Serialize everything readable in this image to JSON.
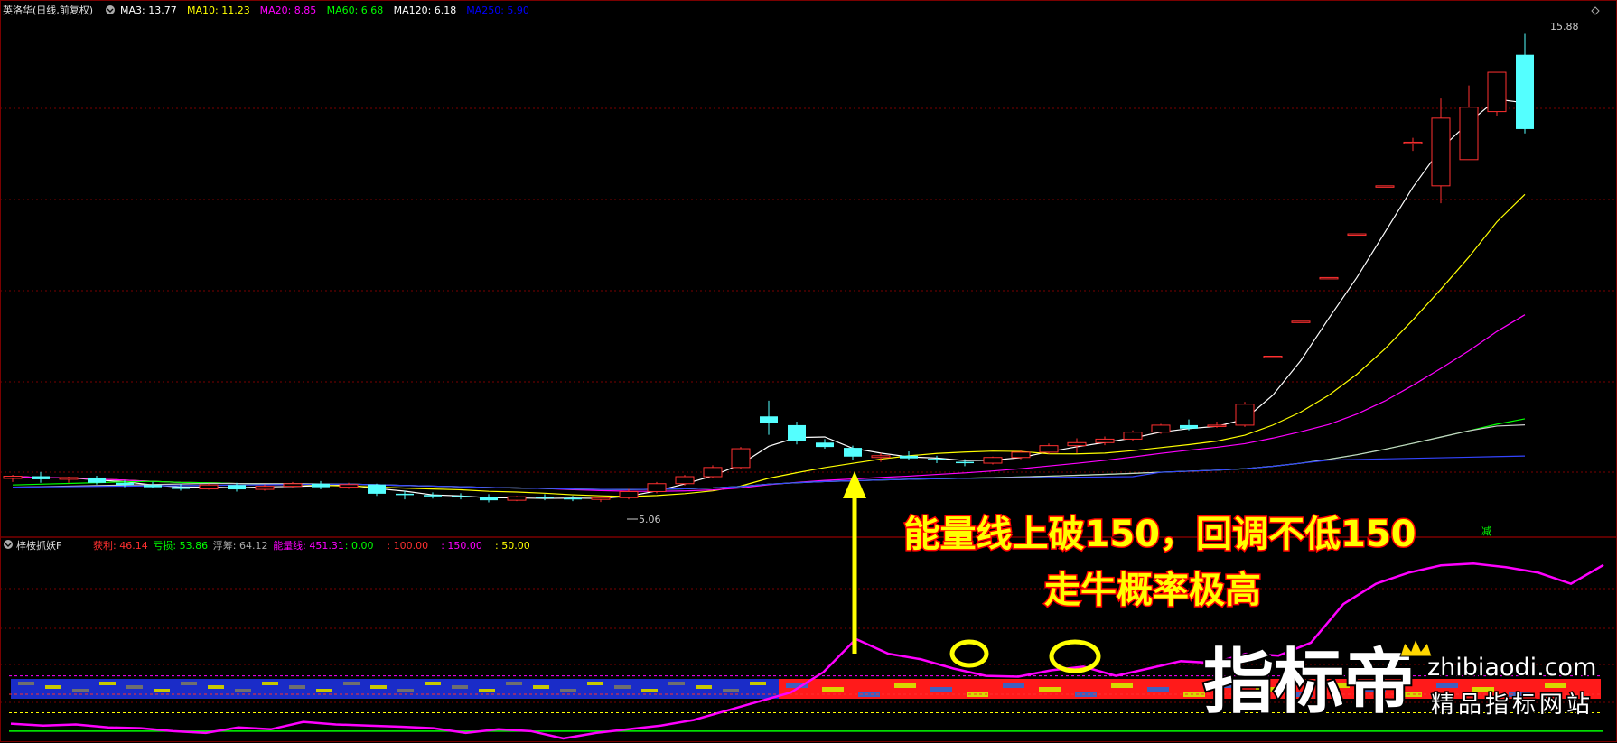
{
  "header": {
    "stock": "英洛华(日线,前复权)",
    "ma": [
      {
        "label": "MA3: 13.77",
        "color": "#ffffff"
      },
      {
        "label": "MA10: 11.23",
        "color": "#ffff00"
      },
      {
        "label": "MA20: 8.85",
        "color": "#ff00ff"
      },
      {
        "label": "MA60: 6.68",
        "color": "#00ff00"
      },
      {
        "label": "MA120: 6.18",
        "color": "#ffffff"
      },
      {
        "label": "MA250: 5.90",
        "color": "#0000ff"
      }
    ]
  },
  "indicator_header": {
    "name": "梓桉抓妖F",
    "items": [
      {
        "label": "获利: 46.14",
        "color": "#ff3030"
      },
      {
        "label": "亏损: 53.86",
        "color": "#00ff00"
      },
      {
        "label": "浮筹: 64.12",
        "color": "#aaaaaa"
      },
      {
        "label": "能量线: 451.31",
        "color": "#ff00ff"
      },
      {
        "label": ": 0.00",
        "color": "#00ff00"
      },
      {
        "label": ": 100.00",
        "color": "#ff3030"
      },
      {
        "label": ": 150.00",
        "color": "#ff00ff"
      },
      {
        "label": ": 50.00",
        "color": "#ffff00"
      }
    ]
  },
  "annotations": {
    "high_price": "15.88",
    "low_price": "5.06",
    "signal_char": "减",
    "headline_1": "能量线上破150，回调不低150",
    "headline_2": "走牛概率极高"
  },
  "watermark": {
    "brand": "指标帝",
    "domain": "zhibiaodi.com",
    "slogan": "精品指标网站"
  },
  "colors": {
    "up": "#ff3030",
    "down": "#54ffff",
    "grid": "#7a0000",
    "energy": "#ff00ff",
    "annotation_text": "#ffff00",
    "annotation_outline": "#ff0000"
  },
  "chart_data": [
    {
      "type": "candlestick",
      "title": "英洛华(日线,前复权)",
      "ylim": [
        4.5,
        16.2
      ],
      "candles": [
        [
          5.7,
          5.78,
          5.62,
          5.75
        ],
        [
          5.75,
          5.85,
          5.6,
          5.68
        ],
        [
          5.68,
          5.74,
          5.6,
          5.72
        ],
        [
          5.72,
          5.76,
          5.56,
          5.6
        ],
        [
          5.6,
          5.66,
          5.5,
          5.55
        ],
        [
          5.55,
          5.62,
          5.48,
          5.5
        ],
        [
          5.5,
          5.58,
          5.42,
          5.46
        ],
        [
          5.46,
          5.58,
          5.44,
          5.55
        ],
        [
          5.55,
          5.6,
          5.4,
          5.45
        ],
        [
          5.45,
          5.56,
          5.42,
          5.52
        ],
        [
          5.52,
          5.62,
          5.48,
          5.58
        ],
        [
          5.58,
          5.64,
          5.45,
          5.5
        ],
        [
          5.5,
          5.6,
          5.46,
          5.56
        ],
        [
          5.56,
          5.58,
          5.3,
          5.35
        ],
        [
          5.35,
          5.42,
          5.22,
          5.32
        ],
        [
          5.32,
          5.38,
          5.24,
          5.3
        ],
        [
          5.3,
          5.36,
          5.22,
          5.28
        ],
        [
          5.28,
          5.34,
          5.15,
          5.2
        ],
        [
          5.2,
          5.3,
          5.18,
          5.28
        ],
        [
          5.28,
          5.34,
          5.2,
          5.25
        ],
        [
          5.25,
          5.3,
          5.18,
          5.22
        ],
        [
          5.22,
          5.28,
          5.16,
          5.26
        ],
        [
          5.26,
          5.46,
          5.22,
          5.4
        ],
        [
          5.4,
          5.62,
          5.36,
          5.58
        ],
        [
          5.58,
          5.78,
          5.54,
          5.74
        ],
        [
          5.74,
          6.0,
          5.7,
          5.95
        ],
        [
          5.95,
          6.42,
          5.92,
          6.38
        ],
        [
          7.12,
          7.48,
          6.7,
          6.98
        ],
        [
          6.92,
          7.0,
          6.48,
          6.55
        ],
        [
          6.52,
          6.6,
          6.38,
          6.42
        ],
        [
          6.4,
          6.45,
          6.12,
          6.2
        ],
        [
          6.18,
          6.28,
          6.08,
          6.22
        ],
        [
          6.22,
          6.32,
          6.12,
          6.16
        ],
        [
          6.15,
          6.22,
          6.05,
          6.12
        ],
        [
          6.08,
          6.14,
          5.98,
          6.05
        ],
        [
          6.05,
          6.2,
          6.02,
          6.18
        ],
        [
          6.18,
          6.35,
          6.14,
          6.3
        ],
        [
          6.3,
          6.5,
          6.26,
          6.45
        ],
        [
          6.45,
          6.62,
          6.28,
          6.52
        ],
        [
          6.52,
          6.66,
          6.46,
          6.6
        ],
        [
          6.6,
          6.8,
          6.55,
          6.76
        ],
        [
          6.76,
          6.95,
          6.72,
          6.92
        ],
        [
          6.92,
          7.05,
          6.8,
          6.84
        ],
        [
          6.9,
          7.0,
          6.86,
          6.92
        ],
        [
          6.92,
          7.45,
          6.88,
          7.4
        ],
        [
          8.5,
          8.5,
          8.5,
          8.5
        ],
        [
          9.3,
          9.3,
          9.3,
          9.3
        ],
        [
          10.3,
          10.3,
          10.3,
          10.3
        ],
        [
          11.3,
          11.3,
          11.3,
          11.3
        ],
        [
          12.4,
          12.4,
          12.4,
          12.4
        ],
        [
          13.4,
          13.5,
          13.2,
          13.4
        ],
        [
          12.4,
          14.4,
          12.0,
          13.95
        ],
        [
          13.0,
          14.7,
          13.0,
          14.2
        ],
        [
          14.1,
          15.0,
          14.0,
          15.0
        ],
        [
          15.4,
          15.88,
          13.6,
          13.7
        ]
      ]
    },
    {
      "type": "line",
      "title": "梓桉抓妖F",
      "ylim": [
        -20,
        480
      ],
      "reference_lines": [
        0,
        50,
        100,
        150
      ],
      "series": [
        {
          "name": "能量线",
          "values": [
            20,
            15,
            18,
            10,
            8,
            0,
            -5,
            10,
            5,
            25,
            18,
            15,
            12,
            8,
            -5,
            5,
            0,
            -20,
            -5,
            5,
            15,
            30,
            55,
            80,
            105,
            160,
            250,
            210,
            195,
            170,
            150,
            148,
            165,
            175,
            150,
            170,
            190,
            185,
            210,
            205,
            240,
            345,
            400,
            430,
            450,
            455,
            445,
            430,
            400,
            451
          ]
        }
      ]
    }
  ]
}
